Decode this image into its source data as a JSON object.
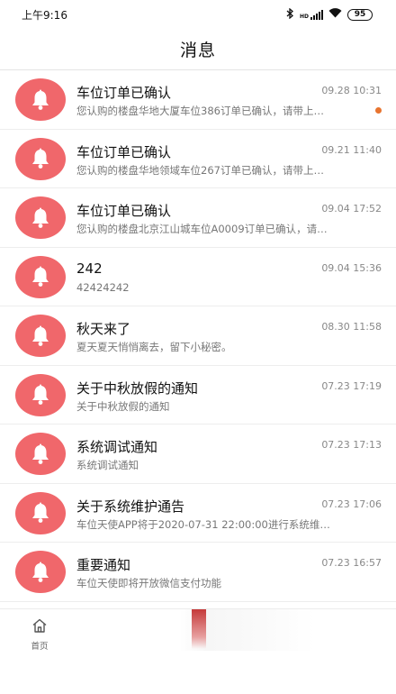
{
  "status_bar": {
    "time": "上午9:16",
    "bluetooth_icon": "bluetooth-icon",
    "network_label": "HD",
    "wifi_icon": "wifi-icon",
    "battery": "95"
  },
  "header": {
    "title": "消息"
  },
  "icons": {
    "message_icon": "bell-icon",
    "home_icon": "home-icon"
  },
  "colors": {
    "avatar_bg": "#f0676b",
    "unread_dot": "#e8742f"
  },
  "messages": [
    {
      "title": "车位订单已确认",
      "time": "09.28 10:31",
      "preview": "您认购的楼盘华地大厦车位386订单已确认，请带上…",
      "unread": true
    },
    {
      "title": "车位订单已确认",
      "time": "09.21 11:40",
      "preview": "您认购的楼盘华地领域车位267订单已确认，请带上…",
      "unread": false
    },
    {
      "title": "车位订单已确认",
      "time": "09.04 17:52",
      "preview": "您认购的楼盘北京江山城车位A0009订单已确认，请…",
      "unread": false
    },
    {
      "title": "242",
      "time": "09.04 15:36",
      "preview": "42424242",
      "unread": false
    },
    {
      "title": "秋天来了",
      "time": "08.30 11:58",
      "preview": "夏天夏天悄悄离去，留下小秘密。",
      "unread": false
    },
    {
      "title": "关于中秋放假的通知",
      "time": "07.23 17:19",
      "preview": "关于中秋放假的通知",
      "unread": false
    },
    {
      "title": "系统调试通知",
      "time": "07.23 17:13",
      "preview": "系统调试通知",
      "unread": false
    },
    {
      "title": "关于系统维护通告",
      "time": "07.23 17:06",
      "preview": "车位天使APP将于2020-07-31 22:00:00进行系统维…",
      "unread": false
    },
    {
      "title": "重要通知",
      "time": "07.23 16:57",
      "preview": "车位天使即将开放微信支付功能",
      "unread": false
    }
  ],
  "tab_bar": {
    "home_label": "首页"
  }
}
